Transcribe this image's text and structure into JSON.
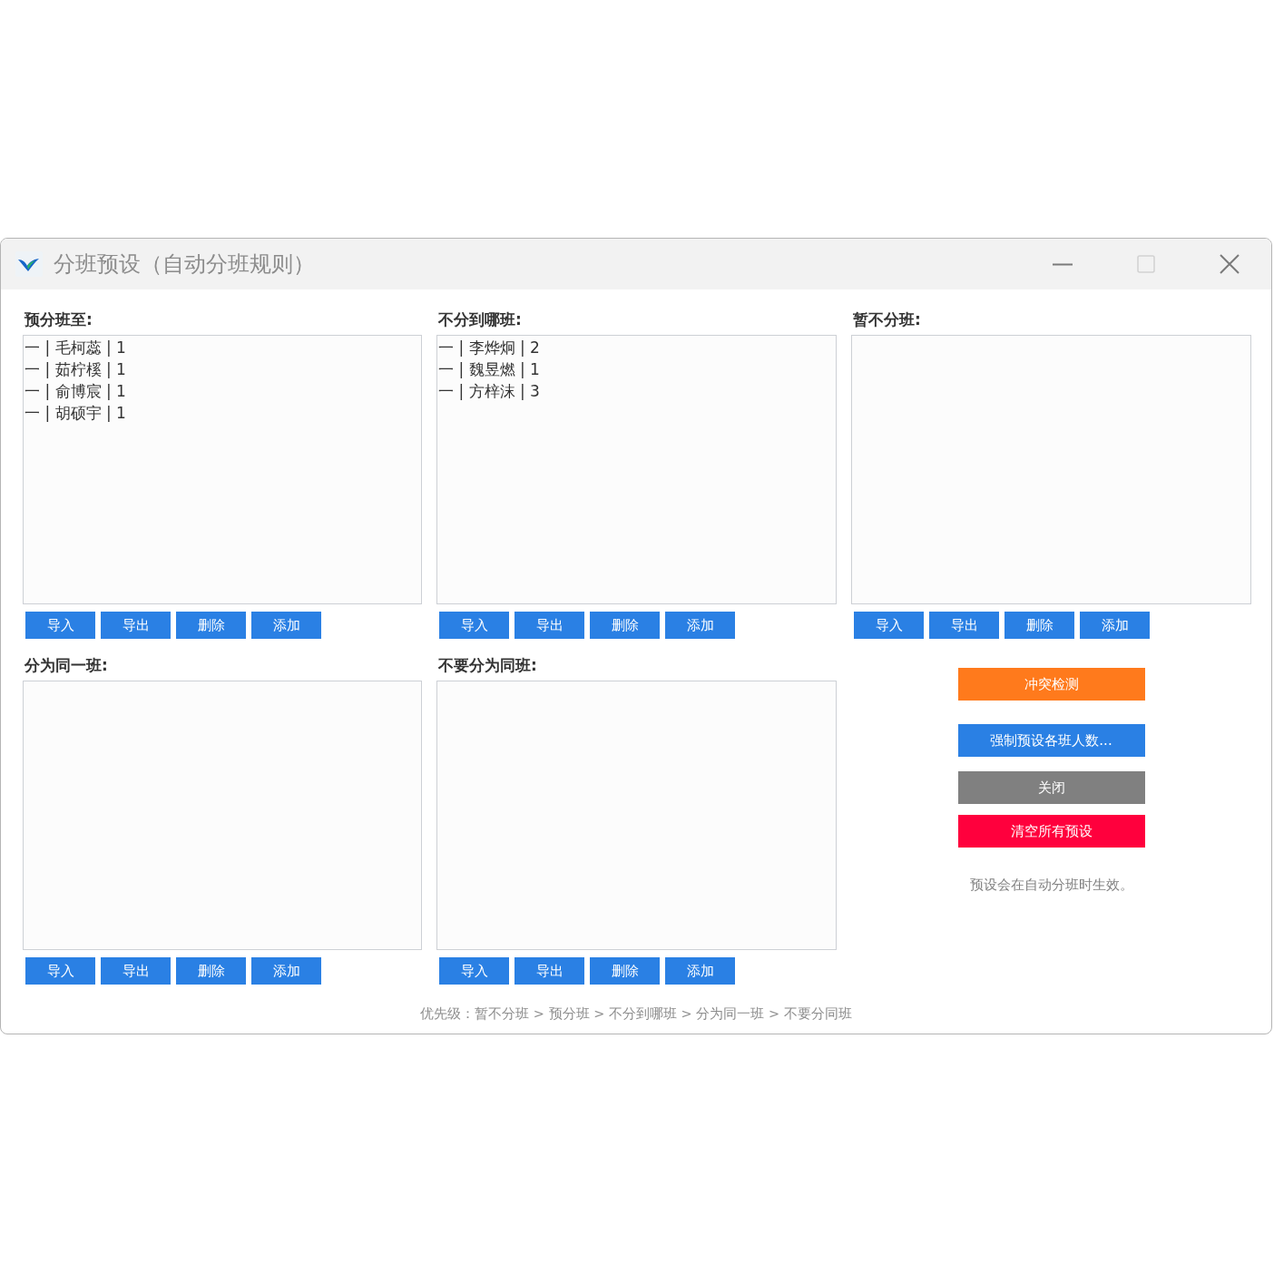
{
  "window": {
    "title": "分班预设（自动分班规则）",
    "controls": [
      {
        "kind": "minimize",
        "disabled": false
      },
      {
        "kind": "maximize",
        "disabled": true
      },
      {
        "kind": "close",
        "disabled": false
      }
    ]
  },
  "panels": [
    {
      "label": "预分班至:",
      "items": [
        "一 | 毛柯蕊 | 1",
        "一 | 茹柠榽 | 1",
        "一 | 俞博宸 | 1",
        "一 | 胡硕宇 | 1"
      ],
      "buttons": [
        "导入",
        "导出",
        "删除",
        "添加"
      ]
    },
    {
      "label": "不分到哪班:",
      "items": [
        "一 | 李烨炯 | 2",
        "一 | 魏昱燃 | 1",
        "一 | 方梓沫 | 3"
      ],
      "buttons": [
        "导入",
        "导出",
        "删除",
        "添加"
      ]
    },
    {
      "label": "暂不分班:",
      "buttons": [
        "导入",
        "导出",
        "删除",
        "添加"
      ]
    },
    {
      "label": "分为同一班:",
      "buttons": [
        "导入",
        "导出",
        "删除",
        "添加"
      ]
    },
    {
      "label": "不要分为同班:",
      "buttons": [
        "导入",
        "导出",
        "删除",
        "添加"
      ]
    }
  ],
  "actions": [
    {
      "label": "冲突检测",
      "kind": "warning"
    },
    {
      "label": "强制预设各班人数...",
      "kind": "primary"
    },
    {
      "label": "关闭",
      "kind": "neutral"
    },
    {
      "label": "清空所有预设",
      "kind": "danger"
    }
  ],
  "note": "预设会在自动分班时生效。",
  "priority": "优先级：暂不分班 > 预分班 > 不分到哪班 > 分为同一班 > 不要分同班"
}
